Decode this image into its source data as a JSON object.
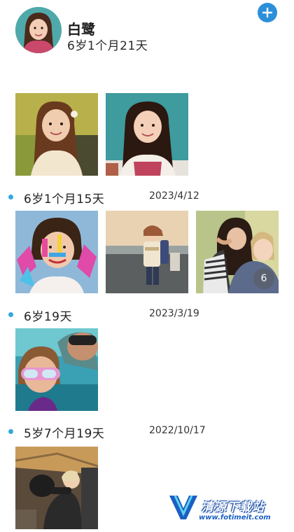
{
  "profile": {
    "name": "白鹭",
    "age": "6岁1个月21天"
  },
  "add_button": {
    "icon": "plus-icon"
  },
  "sections": [
    {
      "age": "",
      "date": "",
      "photo_count": 2
    },
    {
      "age": "6岁1个月15天",
      "date": "2023/4/12",
      "photo_count": 3,
      "more_badge": "6"
    },
    {
      "age": "6岁19天",
      "date": "2023/3/19",
      "photo_count": 1
    },
    {
      "age": "5岁7个月19天",
      "date": "2022/10/17",
      "photo_count": 1
    }
  ],
  "watermark": {
    "title": "清源下载站",
    "url": "www.fotimeit.com"
  },
  "colors": {
    "accent": "#2b8fd9",
    "dot": "#34a7de",
    "watermark": "#1b5fc4"
  }
}
